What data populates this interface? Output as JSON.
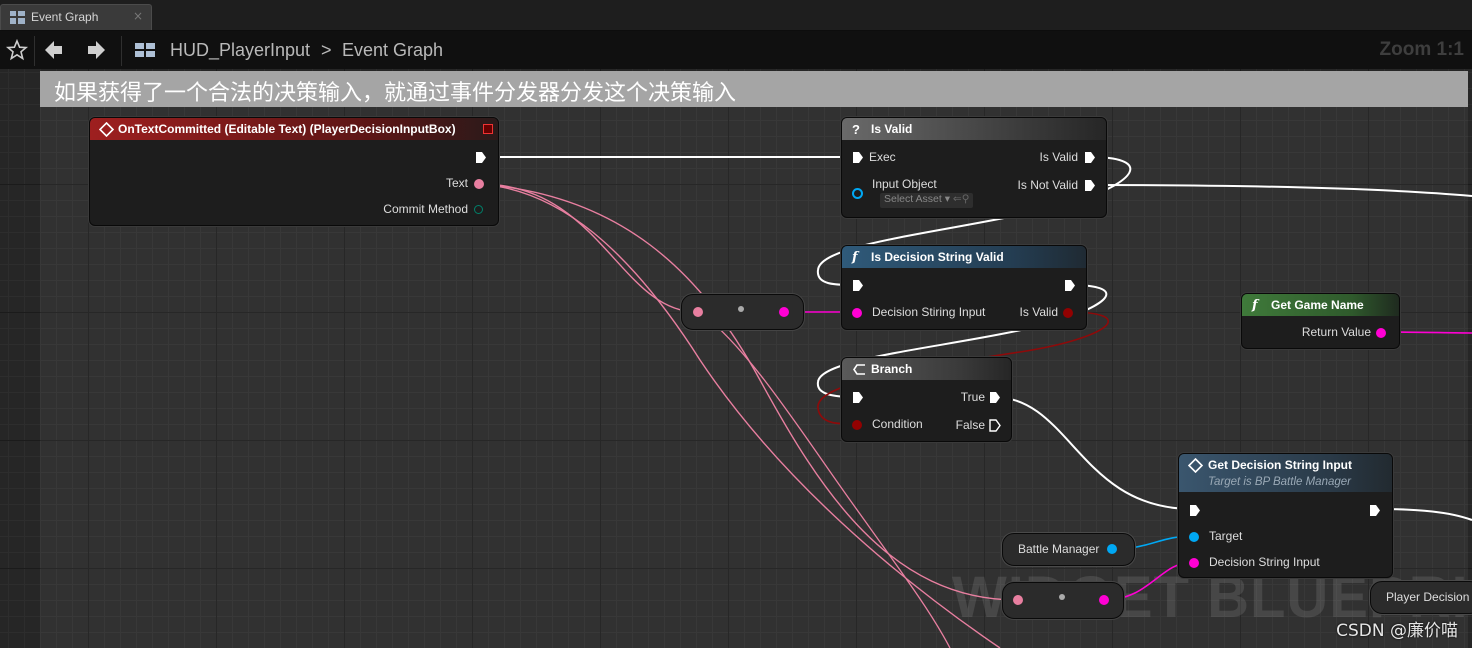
{
  "tab": {
    "label": "Event Graph",
    "close": "×"
  },
  "breadcrumb": {
    "blueprint": "HUD_PlayerInput",
    "separator": ">",
    "graph": "Event Graph"
  },
  "zoom_label": "Zoom 1:1",
  "comment": {
    "text": "如果获得了一个合法的决策输入，就通过事件分发器分发这个决策输入"
  },
  "colors": {
    "event_header": "#8a1c1c",
    "pure_function_header": "#2f5a7a",
    "getter_header": "#3a6b36",
    "exec_wire": "#ffffff",
    "string_pin": "#ff00d4",
    "text_pin": "#e87fa0",
    "bool_pin": "#920101",
    "object_pin": "#00a8f4",
    "enum_pin": "#00806a"
  },
  "nodes": {
    "on_text_committed": {
      "title": "OnTextCommitted (Editable Text) (PlayerDecisionInputBox)",
      "pin_text": "Text",
      "pin_commit": "Commit Method"
    },
    "is_valid": {
      "icon": "?",
      "title": "Is Valid",
      "pin_exec": "Exec",
      "pin_is_valid": "Is Valid",
      "pin_input_object": "Input Object",
      "pin_is_not_valid": "Is Not Valid",
      "select_asset": "Select Asset"
    },
    "is_decision_string_valid": {
      "icon": "f",
      "title": "Is Decision String Valid",
      "pin_input": "Decision Stiring Input",
      "pin_output": "Is Valid"
    },
    "branch": {
      "title": "Branch",
      "pin_true": "True",
      "pin_condition": "Condition",
      "pin_false": "False"
    },
    "get_game_name": {
      "icon": "f",
      "title": "Get Game Name",
      "pin_return": "Return Value"
    },
    "get_decision_string_input": {
      "title": "Get Decision String Input",
      "subtitle": "Target is BP Battle Manager",
      "pin_target": "Target",
      "pin_input": "Decision String Input"
    },
    "battle_manager": {
      "label": "Battle Manager"
    },
    "player_decision": {
      "label": "Player Decision"
    }
  },
  "watermark": "WIDGET BLUEPRINT",
  "credit": "CSDN @廉价喵"
}
